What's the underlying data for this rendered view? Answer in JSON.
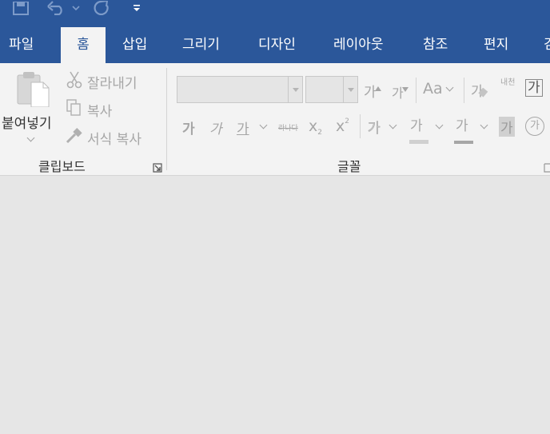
{
  "ribbon_tabs": [
    "파일",
    "홈",
    "삽입",
    "그리기",
    "디자인",
    "레이아웃",
    "참조",
    "편지",
    "검"
  ],
  "clipboard": {
    "paste_label": "붙여넣기",
    "cut_label": "잘라내기",
    "copy_label": "복사",
    "format_painter_label": "서식 복사",
    "group_label": "클립보드"
  },
  "font": {
    "group_label": "글꼴",
    "font_name_value": "",
    "font_size_value": "",
    "grow_font": "가",
    "shrink_font": "가",
    "change_case": "Aa",
    "clear_format": "가",
    "phonetic_guide": "내천",
    "char_border": "가",
    "bold": "가",
    "italic": "가",
    "underline": "가",
    "strikethrough": "라나다",
    "subscript_base": "x",
    "subscript_mark": "2",
    "superscript_base": "x",
    "superscript_mark": "2",
    "text_effects": "가",
    "highlight": "가",
    "font_color": "가",
    "char_shading": "가",
    "enclose_chars": "가"
  },
  "colors": {
    "ribbon_blue": "#2b579a",
    "ribbon_body": "#f3f3f3",
    "document_area": "#e6e6e6",
    "disabled_text": "#a6a6a6"
  }
}
